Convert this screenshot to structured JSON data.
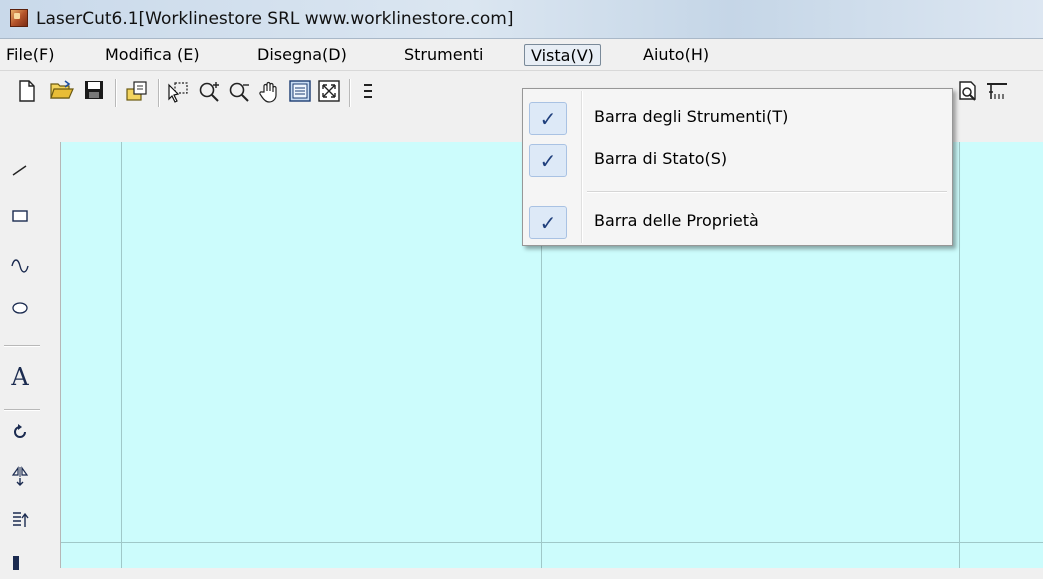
{
  "window": {
    "title": "LaserCut6.1[Worklinestore SRL www.worklinestore.com]"
  },
  "menubar": [
    {
      "label": "File(F)"
    },
    {
      "label": "Modifica (E)"
    },
    {
      "label": "Disegna(D)"
    },
    {
      "label": "Strumenti"
    },
    {
      "label": "Vista(V)",
      "active": true
    },
    {
      "label": "Aiuto(H)"
    }
  ],
  "toolbar": {
    "icons": [
      "new-file-icon",
      "open-folder-icon",
      "save-icon",
      "export-icon",
      "select-icon",
      "zoom-in-icon",
      "zoom-out-icon",
      "pan-hand-icon",
      "view-page-icon",
      "fit-all-icon",
      "print-preview-icon",
      "measure-icon"
    ]
  },
  "left_toolbox": {
    "icons": [
      "line-tool-icon",
      "rectangle-tool-icon",
      "curve-tool-icon",
      "ellipse-tool-icon",
      "text-tool-icon",
      "rotate-tool-icon",
      "mirror-tool-icon",
      "align-tool-icon"
    ],
    "text_tool_label": "A"
  },
  "vista_menu": {
    "items": [
      {
        "label": "Barra degli Strumenti(T)",
        "checked": true
      },
      {
        "label": "Barra di Stato(S)",
        "checked": true
      },
      {
        "label": "Barra delle Proprietà",
        "checked": true
      }
    ],
    "check_glyph": "✓"
  },
  "colors": {
    "canvas": "#ccfcfc",
    "grid": "#9fc8c8",
    "menu_bg": "#f5f5f5"
  }
}
